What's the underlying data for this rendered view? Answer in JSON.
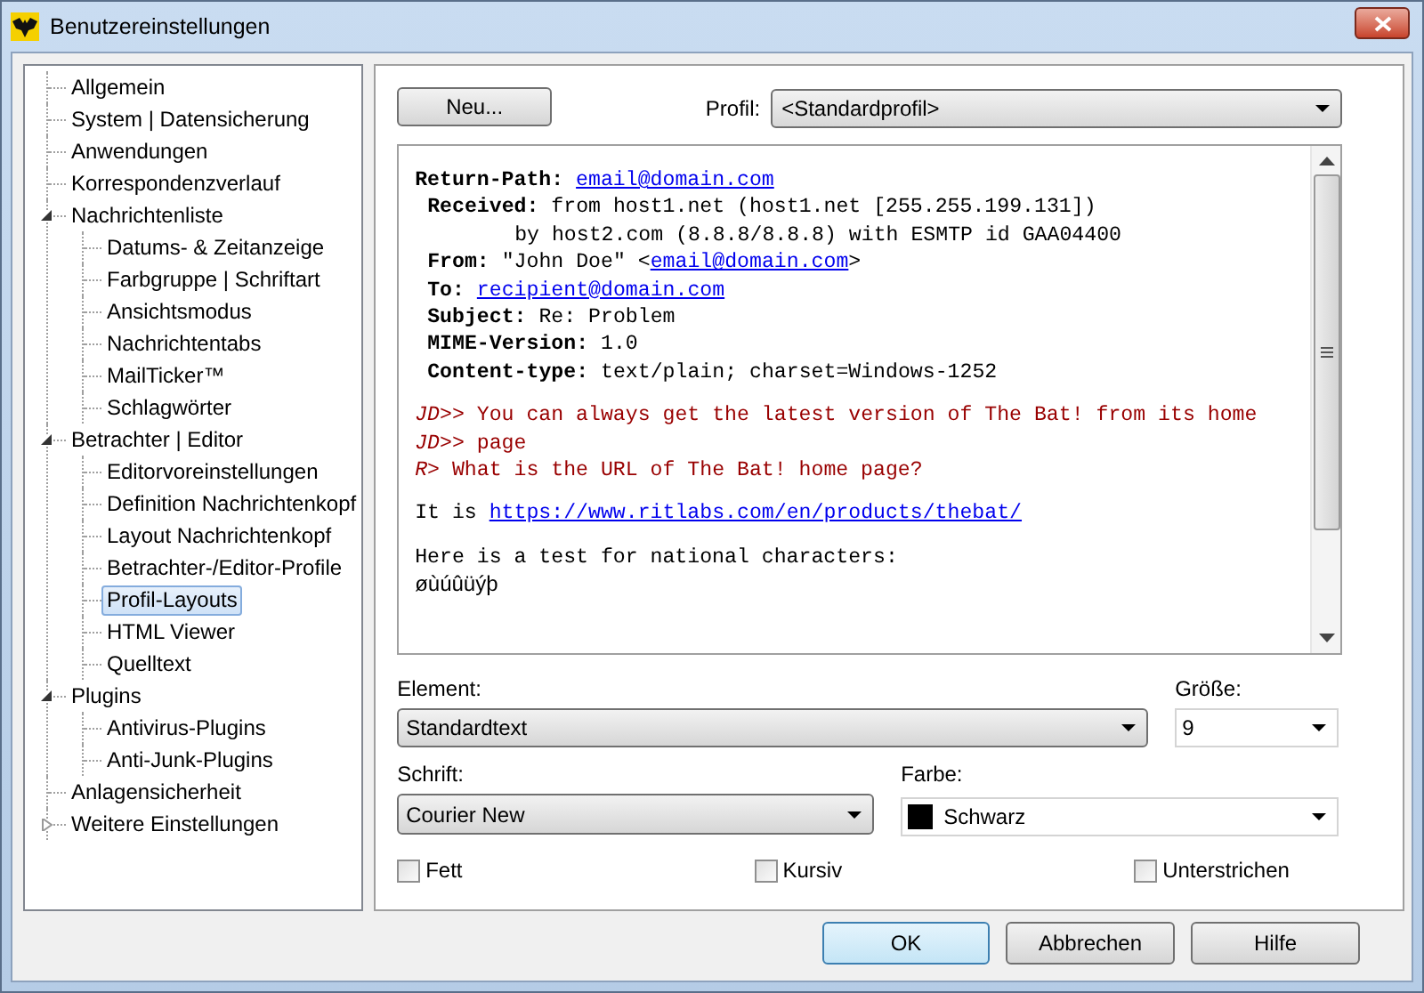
{
  "window": {
    "title": "Benutzereinstellungen"
  },
  "tree": [
    {
      "label": "Allgemein",
      "selected": false
    },
    {
      "label": "System | Datensicherung",
      "selected": false
    },
    {
      "label": "Anwendungen",
      "selected": false
    },
    {
      "label": "Korrespondenzverlauf",
      "selected": false
    },
    {
      "label": "Nachrichtenliste",
      "selected": false,
      "expanded": true,
      "children": [
        {
          "label": "Datums- & Zeitanzeige",
          "selected": false
        },
        {
          "label": "Farbgruppe | Schriftart",
          "selected": false
        },
        {
          "label": "Ansichtsmodus",
          "selected": false
        },
        {
          "label": "Nachrichtentabs",
          "selected": false
        },
        {
          "label": "MailTicker™",
          "selected": false
        },
        {
          "label": "Schlagwörter",
          "selected": false
        }
      ]
    },
    {
      "label": "Betrachter | Editor",
      "selected": false,
      "expanded": true,
      "children": [
        {
          "label": "Editorvoreinstellungen",
          "selected": false
        },
        {
          "label": "Definition Nachrichtenkopf",
          "selected": false
        },
        {
          "label": "Layout Nachrichtenkopf",
          "selected": false
        },
        {
          "label": "Betrachter-/Editor-Profile",
          "selected": false
        },
        {
          "label": "Profil-Layouts",
          "selected": true
        },
        {
          "label": "HTML Viewer",
          "selected": false
        },
        {
          "label": "Quelltext",
          "selected": false
        }
      ]
    },
    {
      "label": "Plugins",
      "selected": false,
      "expanded": true,
      "children": [
        {
          "label": "Antivirus-Plugins",
          "selected": false
        },
        {
          "label": "Anti-Junk-Plugins",
          "selected": false
        }
      ]
    },
    {
      "label": "Anlagensicherheit",
      "selected": false
    },
    {
      "label": "Weitere Einstellungen",
      "selected": false,
      "expanded": false
    }
  ],
  "new_button": "Neu...",
  "profile": {
    "label": "Profil:",
    "value": "<Standardprofil>"
  },
  "preview": [
    {
      "kind": "header",
      "parts": [
        {
          "kind": "label",
          "text": "Return-Path:"
        },
        {
          "kind": "link",
          "text": "email@domain.com"
        }
      ]
    },
    {
      "kind": "header_indented",
      "parts": [
        {
          "kind": "label",
          "text": "Received:"
        },
        {
          "kind": "text",
          "text": "from host1.net (host1.net [255.255.199.131])"
        }
      ]
    },
    {
      "kind": "continuation",
      "parts": [
        {
          "kind": "text",
          "text": "by host2.com (8.8.8/8.8.8) with ESMTP id GAA04400"
        }
      ]
    },
    {
      "kind": "header_indented",
      "parts": [
        {
          "kind": "label",
          "text": "From:"
        },
        {
          "kind": "text_open",
          "text": "\"John Doe\" <"
        },
        {
          "kind": "link",
          "text": "email@domain.com"
        },
        {
          "kind": "text_close",
          "text": ">"
        }
      ]
    },
    {
      "kind": "header_indented",
      "parts": [
        {
          "kind": "label",
          "text": "To:"
        },
        {
          "kind": "link",
          "text": "recipient@domain.com"
        }
      ]
    },
    {
      "kind": "header_indented",
      "parts": [
        {
          "kind": "label",
          "text": "Subject:"
        },
        {
          "kind": "text",
          "text": "Re: Problem"
        }
      ]
    },
    {
      "kind": "header_indented",
      "parts": [
        {
          "kind": "label",
          "text": "MIME-Version:"
        },
        {
          "kind": "text",
          "text": "1.0"
        }
      ]
    },
    {
      "kind": "header_indented",
      "parts": [
        {
          "kind": "label",
          "text": "Content-type:"
        },
        {
          "kind": "text",
          "text": "text/plain; charset=Windows-1252"
        }
      ]
    },
    {
      "kind": "blank"
    },
    {
      "kind": "quote",
      "parts": [
        {
          "kind": "prefix",
          "text": "JD>>"
        },
        {
          "kind": "text",
          "text": "You can always get the latest version of The Bat! from its home"
        }
      ]
    },
    {
      "kind": "quote",
      "parts": [
        {
          "kind": "prefix",
          "text": "JD>>"
        },
        {
          "kind": "text",
          "text": "page"
        }
      ]
    },
    {
      "kind": "quote",
      "parts": [
        {
          "kind": "prefix",
          "text": "R>"
        },
        {
          "kind": "text",
          "text": "What is the URL of The Bat! home page?"
        }
      ]
    },
    {
      "kind": "blank"
    },
    {
      "kind": "body",
      "parts": [
        {
          "kind": "text",
          "text": "It is"
        },
        {
          "kind": "link",
          "text": "https://www.ritlabs.com/en/products/thebat/"
        }
      ]
    },
    {
      "kind": "blank"
    },
    {
      "kind": "body",
      "parts": [
        {
          "kind": "text",
          "text": "Here is a test for national characters:"
        }
      ]
    },
    {
      "kind": "national",
      "parts": [
        {
          "kind": "text",
          "text": "øùúûüýþ"
        }
      ]
    }
  ],
  "element": {
    "label": "Element:",
    "value": "Standardtext"
  },
  "size": {
    "label": "Größe:",
    "value": "9"
  },
  "font": {
    "label": "Schrift:",
    "value": "Courier New"
  },
  "color": {
    "label": "Farbe:",
    "value": "Schwarz",
    "color": "#000000"
  },
  "checkboxes": [
    {
      "label": "Fett",
      "checked": false
    },
    {
      "label": "Kursiv",
      "checked": false
    },
    {
      "label": "Unterstrichen",
      "checked": false
    }
  ],
  "buttons": [
    {
      "label": "OK",
      "default": true
    },
    {
      "label": "Abbrechen",
      "default": false
    },
    {
      "label": "Hilfe",
      "default": false
    }
  ]
}
